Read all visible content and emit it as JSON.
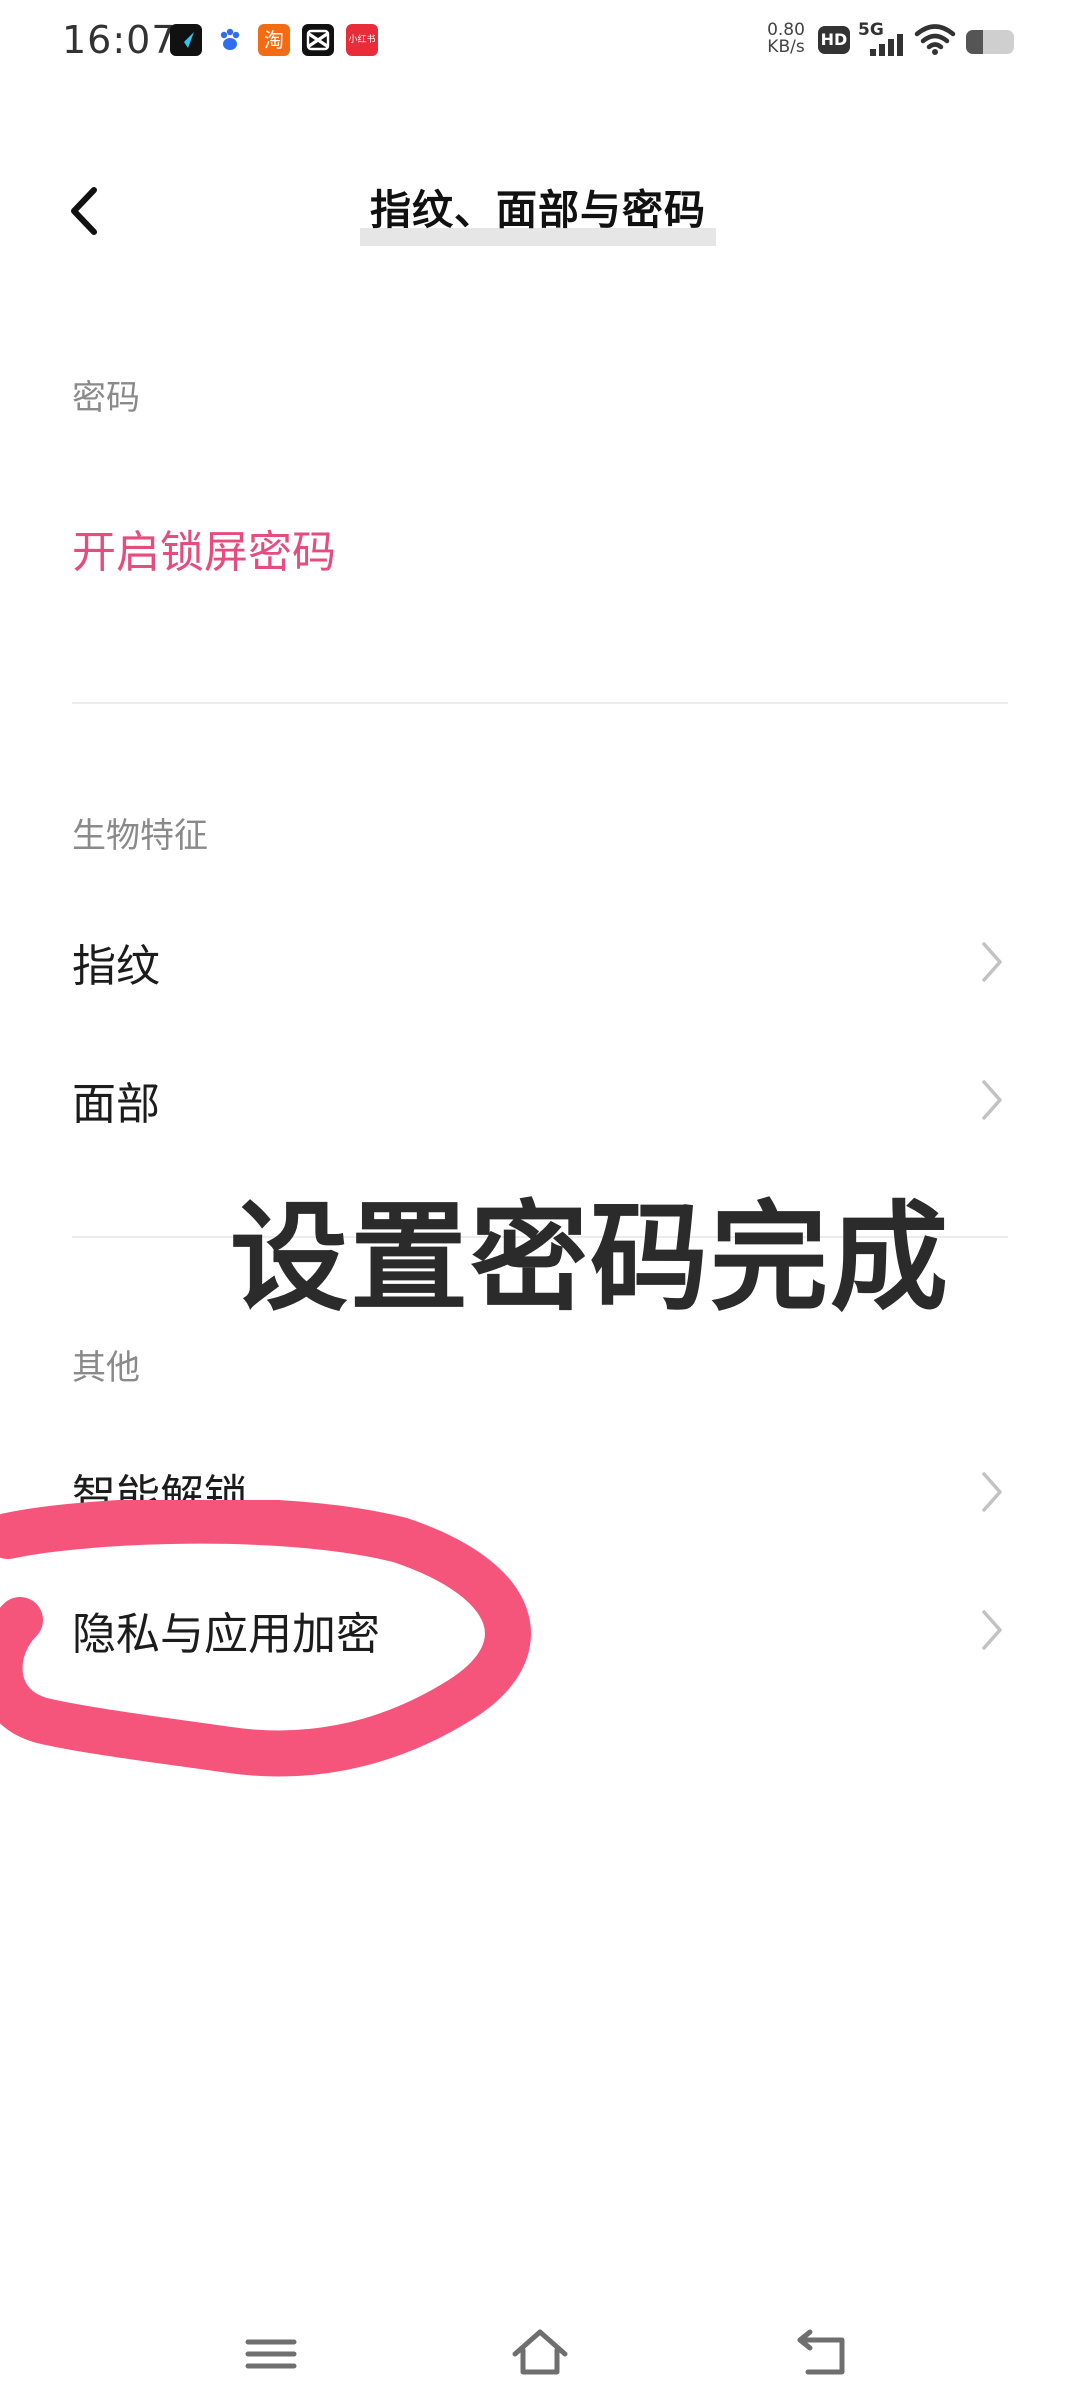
{
  "status_bar": {
    "time": "16:07",
    "network_speed_value": "0.80",
    "network_speed_unit": "KB/s",
    "hd_label": "HD",
    "network_type": "5G",
    "battery_level": 0.35,
    "notification_icons": [
      "navigation-app-icon",
      "baidu-paw-icon",
      "taobao-icon",
      "capcut-icon",
      "xiaohongshu-icon"
    ],
    "notification_colors": [
      "#111111",
      "#2f6cf0",
      "#f36b13",
      "#111111",
      "#ea2b3a"
    ],
    "taobao_glyph": "淘",
    "xhs_glyph": "小红书"
  },
  "header": {
    "title": "指纹、面部与密码"
  },
  "sections": {
    "password": {
      "label": "密码",
      "action_label": "开启锁屏密码",
      "action_color": "#e44d7e"
    },
    "biometrics": {
      "label": "生物特征",
      "items": [
        "指纹",
        "面部"
      ]
    },
    "other": {
      "label": "其他",
      "items": [
        "智能解锁",
        "隐私与应用加密"
      ]
    }
  },
  "overlay": {
    "caption": "设置密码完成",
    "annotation_color": "#f5557a"
  },
  "nav": {
    "buttons": [
      "menu-icon",
      "home-icon",
      "back-icon"
    ]
  }
}
